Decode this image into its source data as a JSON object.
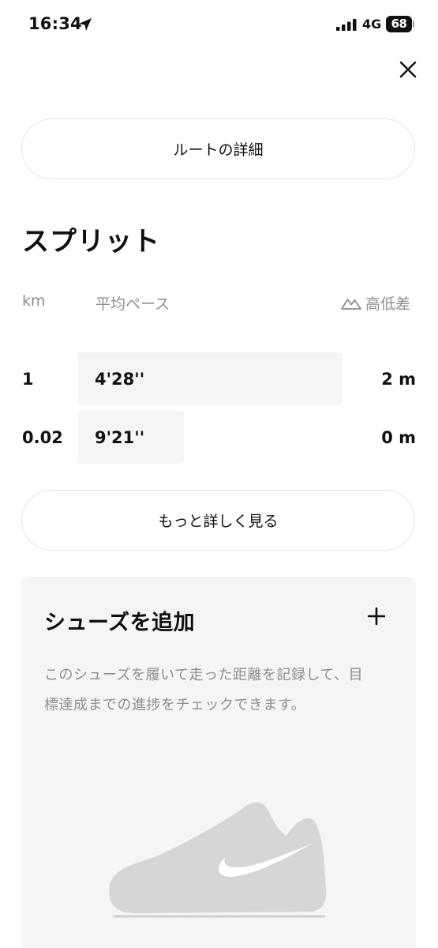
{
  "status_bar": {
    "time": "16:34",
    "network": "4G",
    "battery": "68"
  },
  "route_button_label": "ルートの詳細",
  "splits": {
    "title": "スプリット",
    "headers": {
      "km": "km",
      "pace": "平均ペース",
      "elevation": "高低差"
    },
    "rows": [
      {
        "km": "1",
        "pace": "4'28''",
        "elevation": "2 m",
        "pace_seconds": 268
      },
      {
        "km": "0.02",
        "pace": "9'21''",
        "elevation": "0 m",
        "pace_seconds": 561
      }
    ]
  },
  "more_button_label": "もっと詳しく見る",
  "shoes": {
    "title": "シューズを追加",
    "description": "このシューズを履いて走った距離を記録して、目標達成までの進捗をチェックできます。"
  },
  "colors": {
    "text": "#111111",
    "muted": "#8e8e8e",
    "card_background": "#f5f5f5",
    "pill_border": "#e2e2e2",
    "shoe_gray": "#d6d6d6"
  }
}
